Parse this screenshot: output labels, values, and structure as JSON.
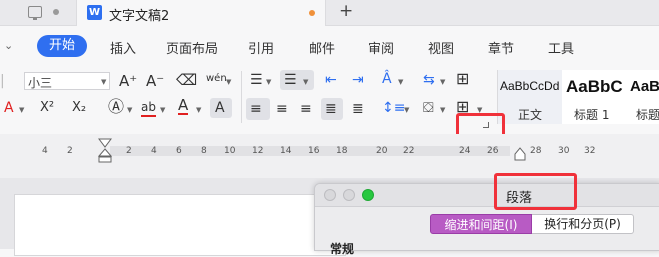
{
  "titlebar": {
    "doc_icon_letter": "W",
    "doc_title": "文字文稿2",
    "new_tab_label": "+"
  },
  "menu": {
    "chevron": "⌄",
    "tabs": [
      "开始",
      "插入",
      "页面布局",
      "引用",
      "邮件",
      "审阅",
      "视图",
      "章节",
      "工具"
    ],
    "active": "开始"
  },
  "ribbon": {
    "font_size": "小三",
    "grow_font": "A⁺",
    "shrink_font": "A⁻",
    "phonetic": "wén",
    "superscript": "X²",
    "subscript": "X₂",
    "strike_ab": "ab"
  },
  "styles": [
    {
      "sample": "AaBbCcDd",
      "name": "正文"
    },
    {
      "sample": "AaBbC",
      "name": "标题 1"
    },
    {
      "sample": "AaB",
      "name": "标题"
    }
  ],
  "ruler": {
    "numbers": [
      "4",
      "2",
      "2",
      "4",
      "6",
      "8",
      "10",
      "12",
      "14",
      "16",
      "18",
      "20",
      "22",
      "24",
      "26",
      "28",
      "30",
      "32"
    ]
  },
  "dialog": {
    "title": "段落",
    "tabs": [
      "缩进和间距(I)",
      "换行和分页(P)"
    ],
    "section": "常规"
  },
  "colors": {
    "accent": "#2f6ff0",
    "highlight": "#f0313a",
    "active_tab": "#b85bc4",
    "font_color_red": "#e02020"
  }
}
